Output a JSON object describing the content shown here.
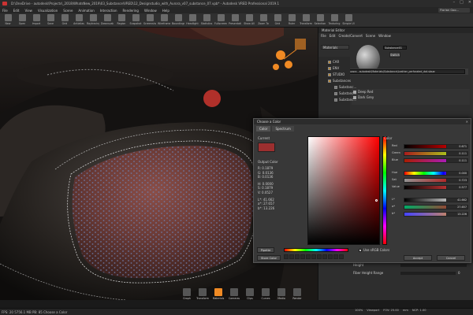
{
  "window": {
    "title": "D:\\OneDrive - autodesk\\Projects\\_2018\\WhatsNew_2019\\03_Substance\\VRED\\12_Designstudio_with_Aurora_v07_substance_07.vpb* - Autodesk VRED Professional 2019.1",
    "user": "Florian Goo..."
  },
  "menu": [
    "File",
    "Edit",
    "View",
    "Visualization",
    "Scene",
    "Animation",
    "Interaction",
    "Rendering",
    "Window",
    "Help"
  ],
  "toolbar": [
    "New",
    "Open",
    "Import",
    "Save",
    "Grid",
    "Antialias",
    "Raytracing",
    "Downscale",
    "Region",
    "Snapshot",
    "Screenshots",
    "Wireframe",
    "Boundings",
    "Headlight",
    "Statistics",
    "Fullscreen",
    "Presentation",
    "Show All",
    "Zoom To",
    "Grid",
    "Ruler",
    "Transform",
    "Selection",
    "Texturing",
    "Simple UI"
  ],
  "material_editor": {
    "title": "Material Editor",
    "menu": [
      "File",
      "Edit",
      "Create/Convert",
      "Scene",
      "Window"
    ],
    "filter_label": "Materials",
    "material_name": "Substance01",
    "link_label": "Switch",
    "path": "aurora - autodesk\\Materials\\Substance\\Leather_perforated_dot.sbsar",
    "tree": [
      {
        "label": "CAR",
        "indent": 0
      },
      {
        "label": "ENV",
        "indent": 0
      },
      {
        "label": "STUDIO",
        "indent": 0
      },
      {
        "label": "Substances",
        "indent": 0
      },
      {
        "label": "Substanc...",
        "indent": 1
      },
      {
        "label": "Substanc...",
        "indent": 1
      },
      {
        "label": "Substanc...",
        "indent": 1
      }
    ],
    "presets_label": "Presets",
    "presets": [
      "Deep Red",
      "Dark Grey"
    ],
    "footer": [
      {
        "label": "Height",
        "value": ""
      },
      {
        "label": "Fiber Height Range",
        "value": "0"
      }
    ]
  },
  "color_dialog": {
    "title": "Choose a Color",
    "tabs": [
      "Color",
      "Spectrum"
    ],
    "current_label": "Current",
    "current_color": "#9c2f2f",
    "output_label": "Output Color",
    "output_values": [
      "R: 0.1879",
      "G: 0.0136",
      "B: 0.0136",
      "H: 0.0000",
      "S: 0.1879",
      "V: 0.0527",
      "L*: 41.662",
      "a*: 27.657",
      "b*: 13.226"
    ],
    "pipette_label": "Pipette",
    "store_label": "Store Color",
    "sliders_title": "Color",
    "sliders": [
      {
        "label": "Red",
        "value": "0.671"
      },
      {
        "label": "Green",
        "value": "0.111"
      },
      {
        "label": "Blue",
        "value": "0.111"
      },
      {
        "label": "Hue",
        "value": "0.000"
      },
      {
        "label": "Sat",
        "value": "0.723"
      },
      {
        "label": "Value",
        "value": "0.577"
      },
      {
        "label": "L*",
        "value": "41.662"
      },
      {
        "label": "a*",
        "value": "27.657"
      },
      {
        "label": "b*",
        "value": "13.226"
      }
    ],
    "use_srgb_label": "Use sRGB Colors",
    "use_srgb": true,
    "accept_label": "Accept",
    "cancel_label": "Cancel"
  },
  "dock": [
    "Graph",
    "Transform",
    "Materials",
    "Cameras",
    "Clips",
    "Curves",
    "Media",
    "Render"
  ],
  "status": {
    "left": "FPS: 20    5756.1 MB    PB: 85    Choose a Color",
    "zoom": "100%",
    "view": "Viewport",
    "fov": "FOV: 25.00",
    "units": "mm",
    "ncp": "NCP: 1.00"
  },
  "colors": {
    "accent": "#f08a24",
    "leather": "#3a3530",
    "seat": "#6a3a36"
  }
}
